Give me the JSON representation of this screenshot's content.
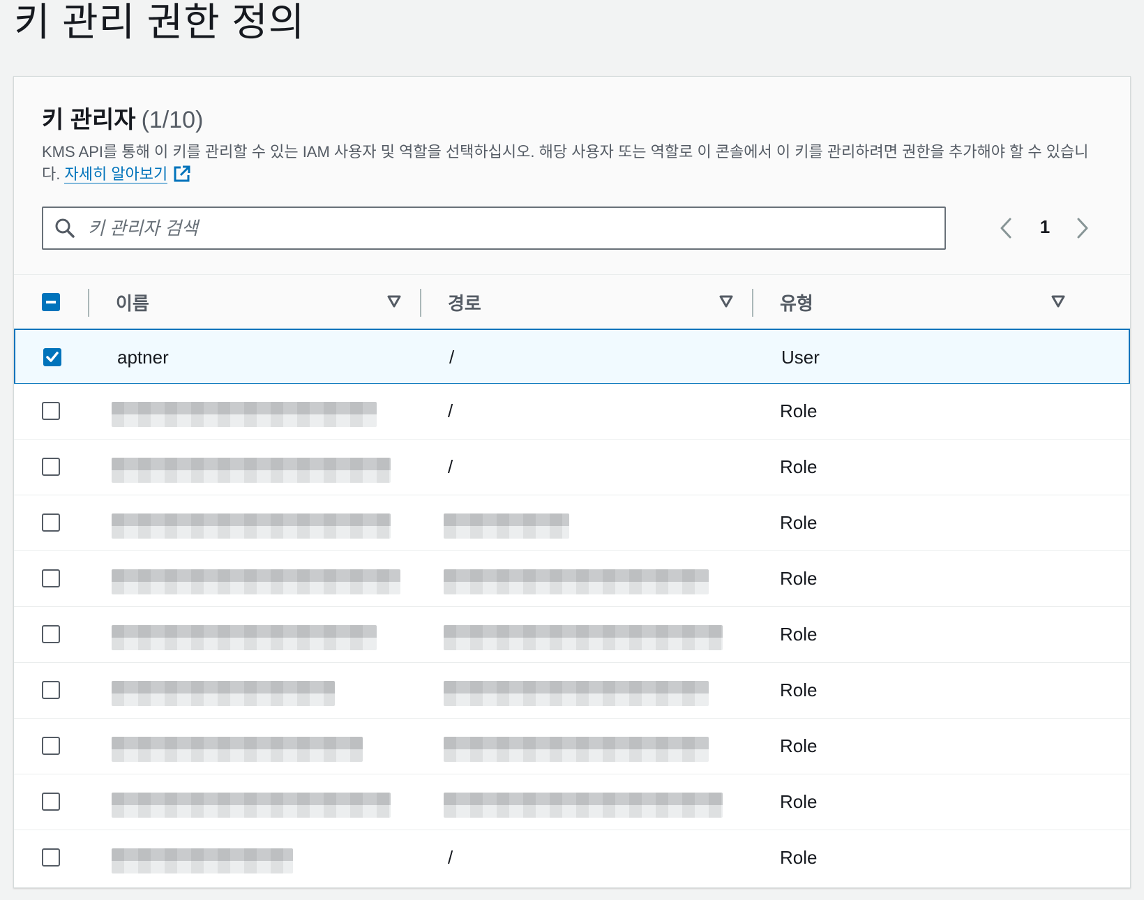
{
  "page": {
    "title": "키 관리 권한 정의"
  },
  "section": {
    "title": "키 관리자",
    "count": "(1/10)",
    "description": "KMS API를 통해 이 키를 관리할 수 있는 IAM 사용자 및 역할을 선택하십시오. 해당 사용자 또는 역할로 이 콘솔에서 이 키를 관리하려면 권한을 추가해야 할 수 있습니다.",
    "learn_more": "자세히 알아보기"
  },
  "search": {
    "placeholder": "키 관리자 검색"
  },
  "pagination": {
    "current_page": "1"
  },
  "table": {
    "headers": {
      "name": "이름",
      "path": "경로",
      "type": "유형"
    },
    "rows": [
      {
        "name": "aptner",
        "path": "/",
        "type": "User",
        "selected": true
      },
      {
        "name": "",
        "path": "/",
        "type": "Role",
        "selected": false
      },
      {
        "name": "",
        "path": "/",
        "type": "Role",
        "selected": false
      },
      {
        "name": "",
        "path": "",
        "type": "Role",
        "selected": false
      },
      {
        "name": "",
        "path": "",
        "type": "Role",
        "selected": false
      },
      {
        "name": "",
        "path": "",
        "type": "Role",
        "selected": false
      },
      {
        "name": "",
        "path": "",
        "type": "Role",
        "selected": false
      },
      {
        "name": "",
        "path": "",
        "type": "Role",
        "selected": false
      },
      {
        "name": "",
        "path": "",
        "type": "Role",
        "selected": false
      },
      {
        "name": "",
        "path": "/",
        "type": "Role",
        "selected": false
      }
    ]
  },
  "colors": {
    "accent": "#0073bb",
    "selected_row_bg": "#f1faff"
  },
  "icons": {
    "search": "search-icon",
    "external_link": "external-link-icon",
    "prev": "chevron-left-icon",
    "next": "chevron-right-icon",
    "sort": "caret-down-icon"
  }
}
